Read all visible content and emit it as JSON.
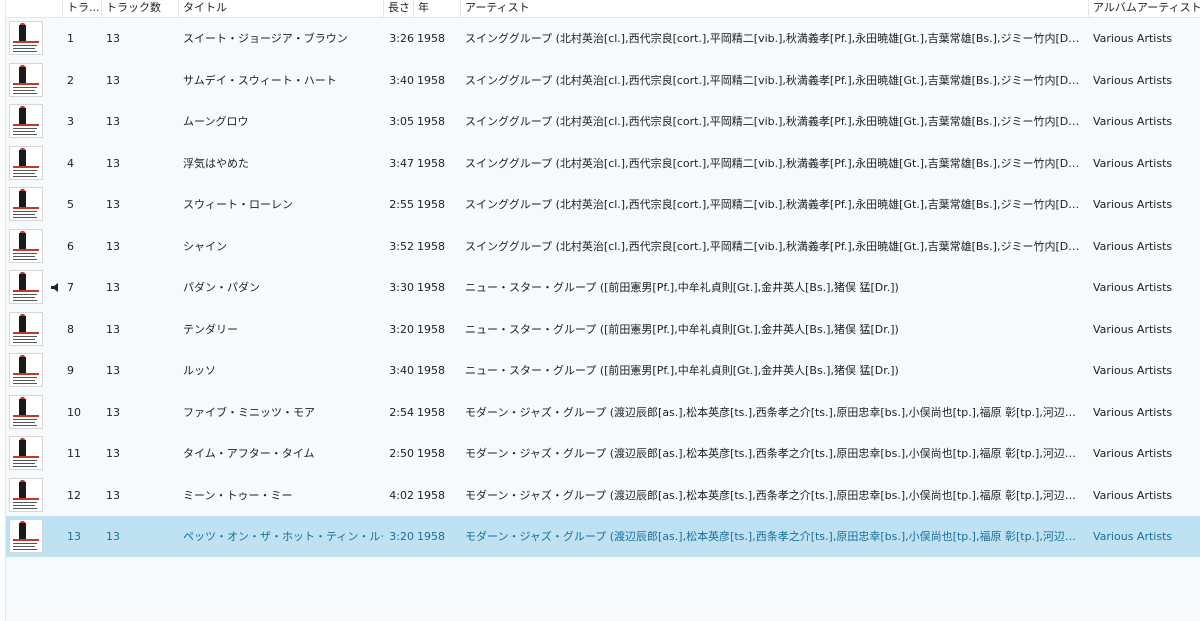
{
  "columns": {
    "track": "トラ...",
    "count": "トラック数",
    "title": "タイトル",
    "length": "長さ",
    "year": "年",
    "artist": "アーティスト",
    "album_artist": "アルバムアーティスト"
  },
  "rows": [
    {
      "track": "1",
      "count": "13",
      "title": "スイート・ジョージア・ブラウン",
      "length": "3:26",
      "year": "1958",
      "artist": "スインググループ (北村英治[cl.],西代宗良[cort.],平岡精二[vib.],秋満義孝[Pf.],永田暁雄[Gt.],吉葉常雄[Bs.],ジミー竹内[Dr.])",
      "album_artist": "Various Artists"
    },
    {
      "track": "2",
      "count": "13",
      "title": "サムデイ・スウィート・ハート",
      "length": "3:40",
      "year": "1958",
      "artist": "スインググループ (北村英治[cl.],西代宗良[cort.],平岡精二[vib.],秋満義孝[Pf.],永田暁雄[Gt.],吉葉常雄[Bs.],ジミー竹内[Dr.])",
      "album_artist": "Various Artists"
    },
    {
      "track": "3",
      "count": "13",
      "title": "ムーングロウ",
      "length": "3:05",
      "year": "1958",
      "artist": "スインググループ (北村英治[cl.],西代宗良[cort.],平岡精二[vib.],秋満義孝[Pf.],永田暁雄[Gt.],吉葉常雄[Bs.],ジミー竹内[Dr.])",
      "album_artist": "Various Artists"
    },
    {
      "track": "4",
      "count": "13",
      "title": "浮気はやめた",
      "length": "3:47",
      "year": "1958",
      "artist": "スインググループ (北村英治[cl.],西代宗良[cort.],平岡精二[vib.],秋満義孝[Pf.],永田暁雄[Gt.],吉葉常雄[Bs.],ジミー竹内[Dr.])",
      "album_artist": "Various Artists"
    },
    {
      "track": "5",
      "count": "13",
      "title": "スウィート・ローレン",
      "length": "2:55",
      "year": "1958",
      "artist": "スインググループ (北村英治[cl.],西代宗良[cort.],平岡精二[vib.],秋満義孝[Pf.],永田暁雄[Gt.],吉葉常雄[Bs.],ジミー竹内[Dr.])",
      "album_artist": "Various Artists"
    },
    {
      "track": "6",
      "count": "13",
      "title": "シャイン",
      "length": "3:52",
      "year": "1958",
      "artist": "スインググループ (北村英治[cl.],西代宗良[cort.],平岡精二[vib.],秋満義孝[Pf.],永田暁雄[Gt.],吉葉常雄[Bs.],ジミー竹内[Dr.])",
      "album_artist": "Various Artists"
    },
    {
      "track": "7",
      "count": "13",
      "title": "パダン・パダン",
      "length": "3:30",
      "year": "1958",
      "artist": "ニュー・スター・グループ ([前田憲男[Pf.],中牟礼貞則[Gt.],金井英人[Bs.],猪俣 猛[Dr.])",
      "album_artist": "Various Artists"
    },
    {
      "track": "8",
      "count": "13",
      "title": "テンダリー",
      "length": "3:20",
      "year": "1958",
      "artist": "ニュー・スター・グループ ([前田憲男[Pf.],中牟礼貞則[Gt.],金井英人[Bs.],猪俣 猛[Dr.])",
      "album_artist": "Various Artists"
    },
    {
      "track": "9",
      "count": "13",
      "title": "ルッソ",
      "length": "3:40",
      "year": "1958",
      "artist": "ニュー・スター・グループ ([前田憲男[Pf.],中牟礼貞則[Gt.],金井英人[Bs.],猪俣 猛[Dr.])",
      "album_artist": "Various Artists"
    },
    {
      "track": "10",
      "count": "13",
      "title": "ファイブ・ミニッツ・モア",
      "length": "2:54",
      "year": "1958",
      "artist": "モダーン・ジャズ・グループ (渡辺辰郎[as.],松本英彦[ts.],西条孝之介[ts.],原田忠幸[bs.],小俣尚也[tp.],福原 彰[tp.],河辺公一[tb.],東本...",
      "album_artist": "Various Artists"
    },
    {
      "track": "11",
      "count": "13",
      "title": "タイム・アフター・タイム",
      "length": "2:50",
      "year": "1958",
      "artist": "モダーン・ジャズ・グループ (渡辺辰郎[as.],松本英彦[ts.],西条孝之介[ts.],原田忠幸[bs.],小俣尚也[tp.],福原 彰[tp.],河辺公一[tb.],東本...",
      "album_artist": "Various Artists"
    },
    {
      "track": "12",
      "count": "13",
      "title": "ミーン・トゥー・ミー",
      "length": "4:02",
      "year": "1958",
      "artist": "モダーン・ジャズ・グループ (渡辺辰郎[as.],松本英彦[ts.],西条孝之介[ts.],原田忠幸[bs.],小俣尚也[tp.],福原 彰[tp.],河辺公一[tb.],東本...",
      "album_artist": "Various Artists"
    },
    {
      "track": "13",
      "count": "13",
      "title": "ペッツ・オン・ザ・ホット・ティン・ルーフ",
      "length": "3:20",
      "year": "1958",
      "artist": "モダーン・ジャズ・グループ (渡辺辰郎[as.],松本英彦[ts.],西条孝之介[ts.],原田忠幸[bs.],小俣尚也[tp.],福原 彰[tp.],河辺公一[tb.],東本...",
      "album_artist": "Various Artists"
    }
  ],
  "now_playing_track": "7",
  "selected_track": "13",
  "colors": {
    "row_bg": "#f7fafd",
    "selected_bg": "#bfe2f2",
    "selected_text": "#1b6f9a"
  }
}
